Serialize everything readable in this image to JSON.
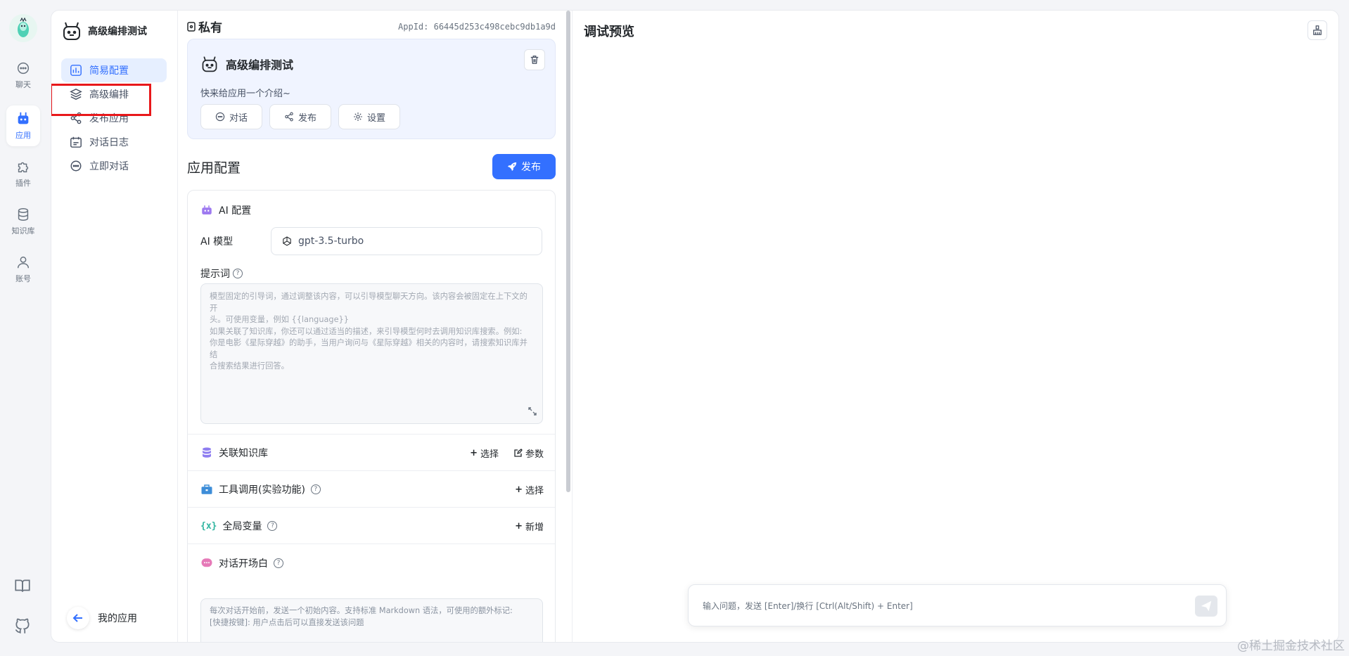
{
  "rail": {
    "items": [
      {
        "label": "聊天",
        "icon": "chat-icon"
      },
      {
        "label": "应用",
        "icon": "robot-icon",
        "active": true
      },
      {
        "label": "插件",
        "icon": "puzzle-icon"
      },
      {
        "label": "知识库",
        "icon": "database-icon"
      },
      {
        "label": "账号",
        "icon": "user-icon"
      }
    ],
    "bottom": [
      {
        "icon": "book-icon"
      },
      {
        "icon": "github-icon"
      }
    ]
  },
  "nav": {
    "app_title": "高级编排测试",
    "items": [
      {
        "label": "简易配置",
        "active": true
      },
      {
        "label": "高级编排"
      },
      {
        "label": "发布应用"
      },
      {
        "label": "对话日志"
      },
      {
        "label": "立即对话"
      }
    ],
    "back_label": "我的应用"
  },
  "config": {
    "visibility": "私有",
    "app_id": "AppId: 66445d253c498cebc9db1a9d",
    "intro": {
      "title": "高级编排测试",
      "desc": "快来给应用一个介绍~",
      "buttons": [
        "对话",
        "发布",
        "设置"
      ]
    },
    "section_title": "应用配置",
    "publish_label": "发布",
    "ai": {
      "title": "AI 配置",
      "model_label": "AI 模型",
      "model_value": "gpt-3.5-turbo",
      "prompt_label": "提示词",
      "prompt_placeholder_lines": [
        "模型固定的引导词，通过调整该内容，可以引导模型聊天方向。该内容会被固定在上下文的开",
        "头。可使用变量，例如 {{language}}",
        "如果关联了知识库，你还可以通过适当的描述，来引导模型何时去调用知识库搜索。例如:",
        "你是电影《星际穿越》的助手，当用户询问与《星际穿越》相关的内容时，请搜索知识库并结",
        "合搜索结果进行回答。"
      ]
    },
    "dataset": {
      "title": "关联知识库",
      "select": "选择",
      "params": "参数"
    },
    "tools": {
      "title": "工具调用(实验功能)",
      "select": "选择"
    },
    "variables": {
      "title": "全局变量",
      "add": "新增"
    },
    "welcome": {
      "title": "对话开场白",
      "placeholder_lines": [
        "每次对话开始前，发送一个初始内容。支持标准 Markdown 语法，可使用的额外标记:",
        "[快捷按键]: 用户点击后可以直接发送该问题"
      ]
    }
  },
  "preview": {
    "title": "调试预览",
    "input_placeholder": "输入问题，发送 [Enter]/换行 [Ctrl(Alt/Shift) + Enter]"
  },
  "watermark": "@稀土掘金技术社区",
  "colors": {
    "accent": "#3370ff",
    "highlight": "#e8181b"
  }
}
